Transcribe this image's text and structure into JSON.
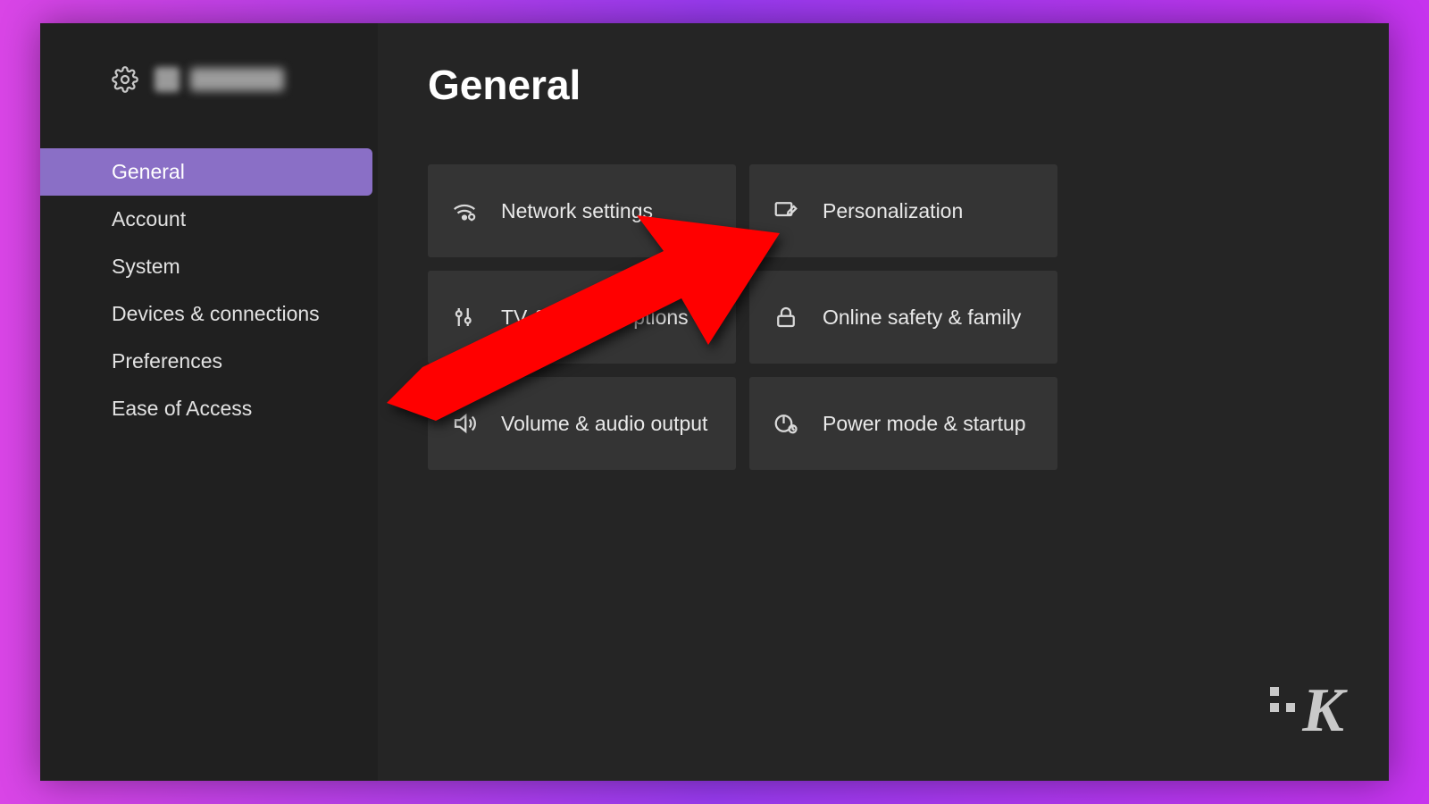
{
  "colors": {
    "accent": "#8a6fc6",
    "annotation": "#ff0000"
  },
  "header": {
    "profile_name": "█████"
  },
  "sidebar": {
    "items": [
      {
        "label": "General",
        "active": true
      },
      {
        "label": "Account",
        "active": false
      },
      {
        "label": "System",
        "active": false
      },
      {
        "label": "Devices & connections",
        "active": false
      },
      {
        "label": "Preferences",
        "active": false
      },
      {
        "label": "Ease of Access",
        "active": false
      }
    ]
  },
  "main": {
    "title": "General",
    "tiles": [
      {
        "icon": "network-icon",
        "label": "Network settings"
      },
      {
        "icon": "personalize-icon",
        "label": "Personalization"
      },
      {
        "icon": "sliders-icon",
        "label": "TV & display options"
      },
      {
        "icon": "lock-icon",
        "label": "Online safety & family"
      },
      {
        "icon": "volume-icon",
        "label": "Volume & audio output"
      },
      {
        "icon": "power-icon",
        "label": "Power mode & startup"
      }
    ]
  },
  "annotation": {
    "type": "arrow",
    "points_to": "Personalization"
  },
  "watermark": {
    "text": "K"
  }
}
